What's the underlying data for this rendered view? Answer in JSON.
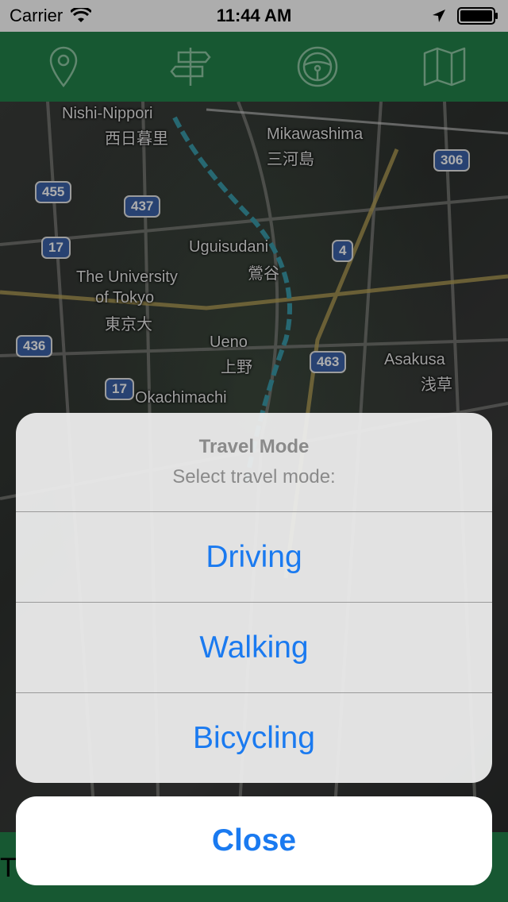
{
  "status_bar": {
    "carrier": "Carrier",
    "time": "11:44 AM"
  },
  "toolbar": {
    "icons": [
      "location-pin-icon",
      "signpost-icon",
      "steering-wheel-icon",
      "map-icon"
    ]
  },
  "map": {
    "labels": [
      {
        "text": "Nishi-Nippori"
      },
      {
        "text": "西日暮里"
      },
      {
        "text": "Mikawashima"
      },
      {
        "text": "三河島"
      },
      {
        "text": "Uguisudani"
      },
      {
        "text": "鶯谷"
      },
      {
        "text": "The University"
      },
      {
        "text": "of Tokyo"
      },
      {
        "text": "東京大"
      },
      {
        "text": "Ueno"
      },
      {
        "text": "上野"
      },
      {
        "text": "Asakusa"
      },
      {
        "text": "浅草"
      },
      {
        "text": "Okachimachi"
      }
    ],
    "shields": [
      "306",
      "455",
      "437",
      "17",
      "4",
      "436",
      "463",
      "17"
    ]
  },
  "action_sheet": {
    "title": "Travel Mode",
    "message": "Select travel mode:",
    "options": [
      "Driving",
      "Walking",
      "Bicycling"
    ],
    "cancel": "Close"
  },
  "bottom_bar": {
    "text": "T"
  },
  "colors": {
    "toolbar": "#23824a",
    "accent": "#1a7af0"
  }
}
